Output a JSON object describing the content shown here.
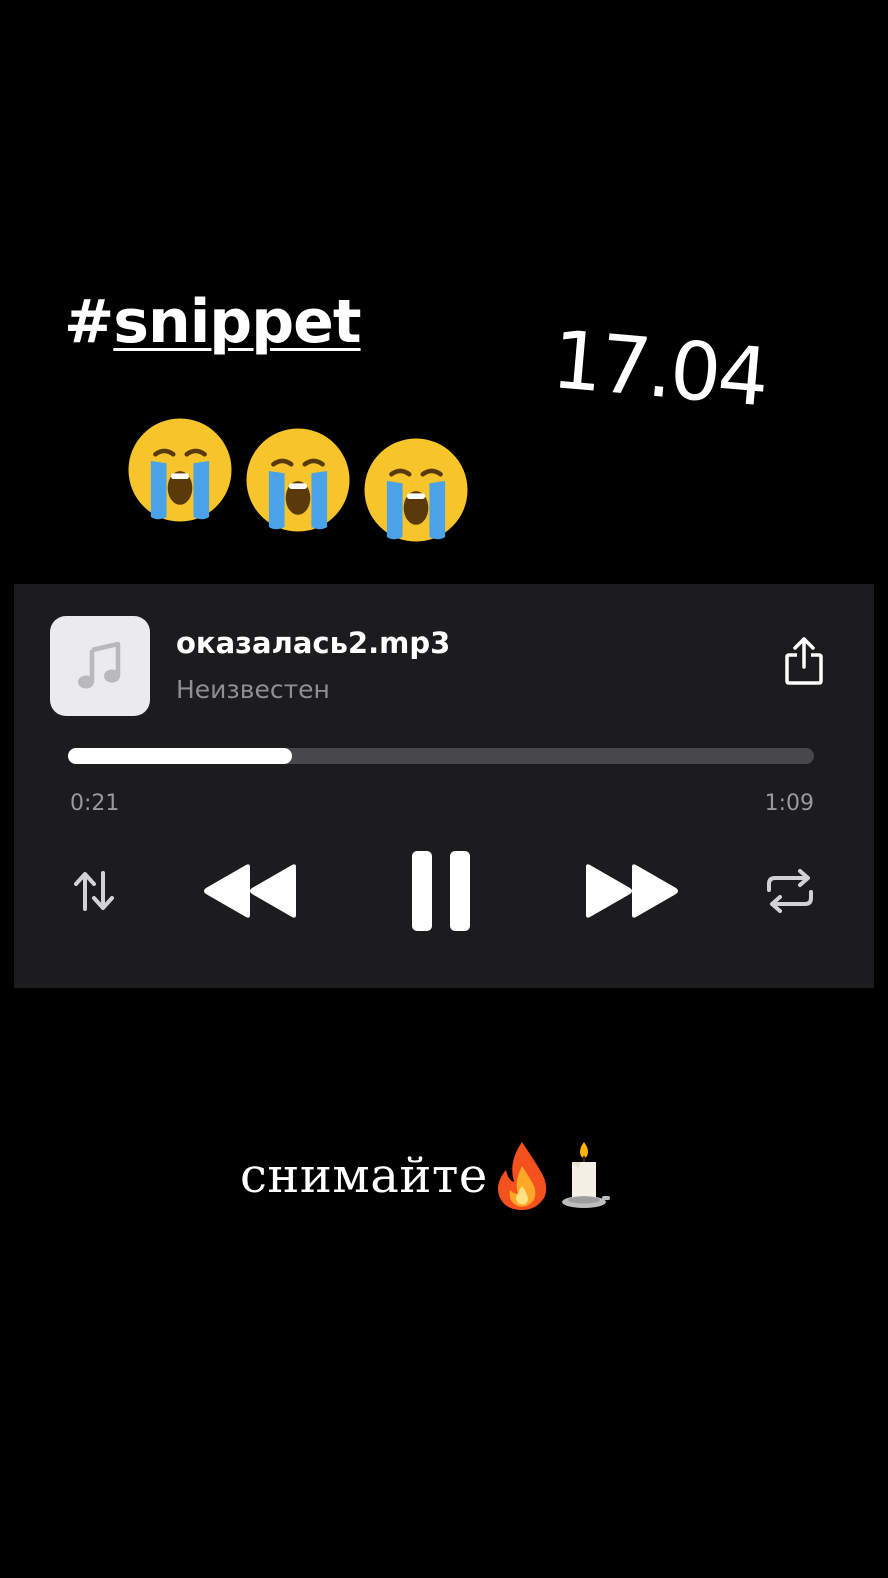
{
  "story": {
    "hashtag_symbol": "#",
    "hashtag_word": "snippet",
    "date": "17.04",
    "reaction_emojis": [
      "loudly-crying-face",
      "loudly-crying-face",
      "loudly-crying-face"
    ],
    "caption": "снимайте",
    "caption_emojis": [
      "fire",
      "candle"
    ]
  },
  "player": {
    "title": "оказалась2.mp3",
    "artist": "Неизвестен",
    "elapsed": "0:21",
    "duration": "1:09",
    "progress_fraction": 0.3,
    "artwork_icon": "music-note-icon",
    "share_icon": "share-icon",
    "controls": {
      "shuffle_icon": "shuffle-icon",
      "prev_icon": "rewind-icon",
      "play_state": "playing",
      "pause_icon": "pause-icon",
      "next_icon": "fast-forward-icon",
      "repeat_icon": "repeat-icon"
    },
    "colors": {
      "card_background": "#1c1c1e",
      "track_unfilled": "#48484a",
      "track_filled": "#ffffff",
      "secondary_text": "#8e8e93"
    }
  }
}
